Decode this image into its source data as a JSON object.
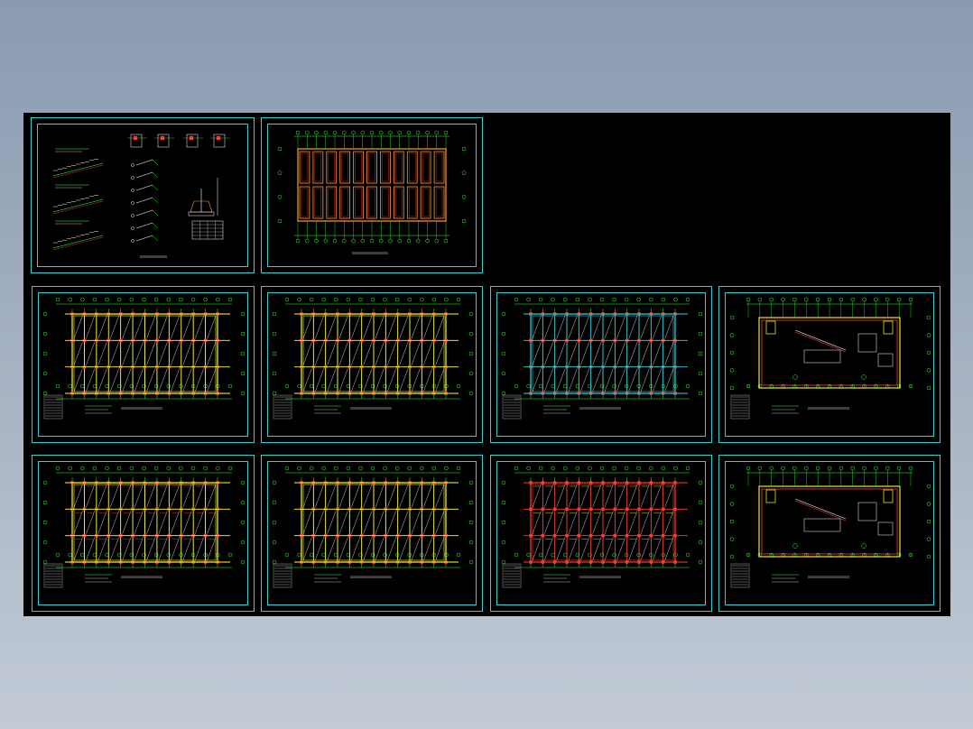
{
  "colors": {
    "background_top": "#8a9ab0",
    "background_bottom": "#c2cbd6",
    "canvas": "#000000",
    "frame": "#2fd3d3",
    "grid": "#2fff2f",
    "beam": "#ffff33",
    "column": "#ff3b30",
    "slab": "#ff9b2f",
    "text": "#e6e6e6"
  },
  "sheets": [
    {
      "id": "sheet-stair-details",
      "kind": "details",
      "caption": ""
    },
    {
      "id": "sheet-foundation-plan",
      "kind": "foundation",
      "caption": ""
    },
    {
      "id": "sheet-floor-1",
      "kind": "floor",
      "variant": "yellow",
      "caption": ""
    },
    {
      "id": "sheet-floor-2",
      "kind": "floor",
      "variant": "yellow",
      "caption": ""
    },
    {
      "id": "sheet-floor-3",
      "kind": "floor",
      "variant": "cyan",
      "caption": ""
    },
    {
      "id": "sheet-roof-1",
      "kind": "roof",
      "caption": ""
    },
    {
      "id": "sheet-floor-4",
      "kind": "floor",
      "variant": "yellow-dense",
      "caption": ""
    },
    {
      "id": "sheet-floor-5",
      "kind": "floor",
      "variant": "yellow",
      "caption": ""
    },
    {
      "id": "sheet-floor-6",
      "kind": "floor",
      "variant": "red",
      "caption": ""
    },
    {
      "id": "sheet-roof-2",
      "kind": "roof",
      "caption": ""
    }
  ]
}
